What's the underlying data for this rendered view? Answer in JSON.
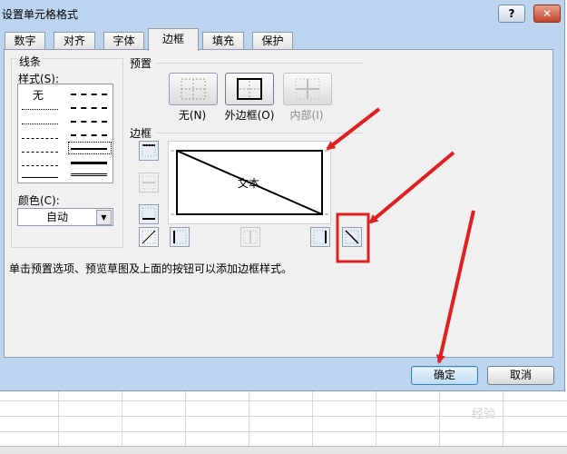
{
  "window": {
    "title": "设置单元格格式",
    "help_label": "?",
    "close_label": "✕"
  },
  "tabs": [
    {
      "label": "数字",
      "active": false
    },
    {
      "label": "对齐",
      "active": false
    },
    {
      "label": "字体",
      "active": false
    },
    {
      "label": "边框",
      "active": true
    },
    {
      "label": "填充",
      "active": false
    },
    {
      "label": "保护",
      "active": false
    }
  ],
  "line_group": {
    "title": "线条",
    "style_label": "样式(S):",
    "style_none": "无",
    "color_label": "颜色(C):",
    "color_value": "自动"
  },
  "presets_group": {
    "title": "预置",
    "none_label": "无(N)",
    "outline_label": "外边框(O)",
    "inside_label": "内部(I)"
  },
  "border_group": {
    "title": "边框",
    "preview_text": "文本"
  },
  "description": "单击预置选项、预览草图及上面的按钮可以添加边框样式。",
  "buttons": {
    "ok": "确定",
    "cancel": "取消"
  },
  "annotations": {
    "arrow_color": "#e02020",
    "highlight_color": "#e02020"
  },
  "watermark": "经验"
}
